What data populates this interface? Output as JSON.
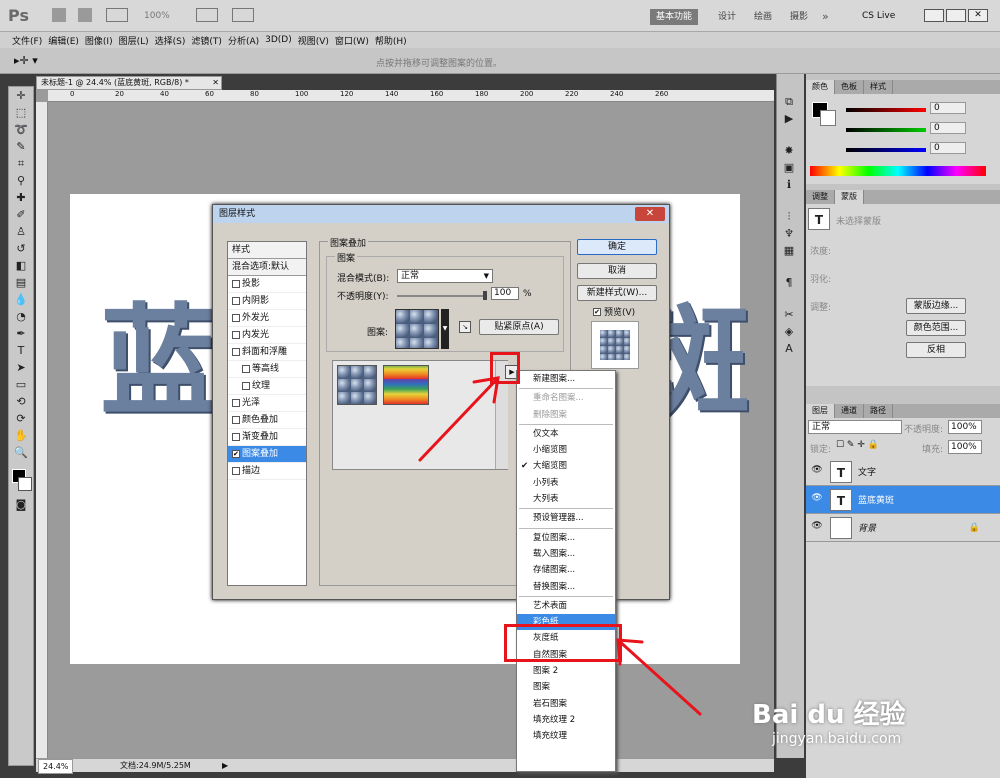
{
  "app": {
    "logo": "Ps",
    "zoom": "100%",
    "workspaces": [
      "基本功能",
      "设计",
      "绘画",
      "摄影"
    ],
    "cs_live": "CS Live"
  },
  "menu": [
    "文件(F)",
    "编辑(E)",
    "图像(I)",
    "图层(L)",
    "选择(S)",
    "滤镜(T)",
    "分析(A)",
    "3D(D)",
    "视图(V)",
    "窗口(W)",
    "帮助(H)"
  ],
  "options_hint": "点按并拖移可调整图案的位置。",
  "document": {
    "tab_title": "未标题-1 @ 24.4% (蓝底黄斑, RGB/8) *",
    "canvas_text_left": "蓝",
    "canvas_text_right": "斑",
    "ruler_marks": [
      "0",
      "20",
      "40",
      "60",
      "80",
      "100",
      "120",
      "140",
      "160",
      "180",
      "200",
      "220",
      "240",
      "260"
    ]
  },
  "status": {
    "zoom": "24.4%",
    "doc": "文档:24.9M/5.25M"
  },
  "dialog": {
    "title": "图层样式",
    "styles_header": "样式",
    "blend_default": "混合选项:默认",
    "styles": [
      {
        "label": "投影",
        "checked": false,
        "indent": false
      },
      {
        "label": "内阴影",
        "checked": false,
        "indent": false
      },
      {
        "label": "外发光",
        "checked": false,
        "indent": false
      },
      {
        "label": "内发光",
        "checked": false,
        "indent": false
      },
      {
        "label": "斜面和浮雕",
        "checked": false,
        "indent": false
      },
      {
        "label": "等高线",
        "checked": false,
        "indent": true
      },
      {
        "label": "纹理",
        "checked": false,
        "indent": true
      },
      {
        "label": "光泽",
        "checked": false,
        "indent": false
      },
      {
        "label": "颜色叠加",
        "checked": false,
        "indent": false
      },
      {
        "label": "渐变叠加",
        "checked": false,
        "indent": false
      },
      {
        "label": "图案叠加",
        "checked": true,
        "indent": false
      },
      {
        "label": "描边",
        "checked": false,
        "indent": false
      }
    ],
    "section_title": "图案叠加",
    "group_title": "图案",
    "blend_mode_label": "混合模式(B):",
    "blend_mode_value": "正常",
    "opacity_label": "不透明度(Y):",
    "opacity_value": "100",
    "opacity_unit": "%",
    "opacity_fraction": 1.0,
    "pattern_label": "图案:",
    "snap_button": "贴紧原点(A)",
    "ok": "确定",
    "cancel": "取消",
    "new_style": "新建样式(W)...",
    "preview": "预览(V)",
    "close": "✕"
  },
  "popup_menu": [
    {
      "label": "新建图案...",
      "state": "normal"
    },
    {
      "sep": true
    },
    {
      "label": "重命名图案...",
      "state": "disabled"
    },
    {
      "label": "删除图案",
      "state": "disabled"
    },
    {
      "sep": true
    },
    {
      "label": "仅文本",
      "state": "normal"
    },
    {
      "label": "小缩览图",
      "state": "normal"
    },
    {
      "label": "大缩览图",
      "state": "checked"
    },
    {
      "label": "小列表",
      "state": "normal"
    },
    {
      "label": "大列表",
      "state": "normal"
    },
    {
      "sep": true
    },
    {
      "label": "预设管理器...",
      "state": "normal"
    },
    {
      "sep": true
    },
    {
      "label": "复位图案...",
      "state": "normal"
    },
    {
      "label": "载入图案...",
      "state": "normal"
    },
    {
      "label": "存储图案...",
      "state": "normal"
    },
    {
      "label": "替换图案...",
      "state": "normal"
    },
    {
      "sep": true
    },
    {
      "label": "艺术表面",
      "state": "normal"
    },
    {
      "label": "彩色纸",
      "state": "highlight"
    },
    {
      "label": "灰度纸",
      "state": "normal"
    },
    {
      "label": "自然图案",
      "state": "normal"
    },
    {
      "label": "图案 2",
      "state": "normal"
    },
    {
      "label": "图案",
      "state": "normal"
    },
    {
      "label": "岩石图案",
      "state": "normal"
    },
    {
      "label": "填充纹理 2",
      "state": "normal"
    },
    {
      "label": "填充纹理",
      "state": "normal"
    }
  ],
  "panels": {
    "color_tabs": [
      "颜色",
      "色板",
      "样式"
    ],
    "rgb_values": [
      "0",
      "0",
      "0"
    ],
    "adjust_tabs": [
      "调整",
      "蒙版"
    ],
    "mask_hint": "未选择蒙版",
    "mask_labels": [
      "浓度:",
      "羽化:",
      "调整:"
    ],
    "mask_buttons": [
      "蒙版边缘...",
      "颜色范围...",
      "反相"
    ],
    "layers_tabs": [
      "图层",
      "通道",
      "路径"
    ],
    "blend": "正常",
    "opacity_label": "不透明度:",
    "opacity": "100%",
    "lock_label": "锁定:",
    "fill_label": "填充:",
    "fill": "100%",
    "layers": [
      {
        "name": "文字",
        "type": "T",
        "selected": false
      },
      {
        "name": "蓝底黄斑",
        "type": "T",
        "selected": true
      },
      {
        "name": "背景",
        "type": "bg",
        "selected": false
      }
    ]
  },
  "watermark": {
    "brand": "Bai du 经验",
    "url": "jingyan.baidu.com"
  },
  "colors": {
    "accent": "#3a8ae6",
    "annotation": "#e8141c"
  }
}
